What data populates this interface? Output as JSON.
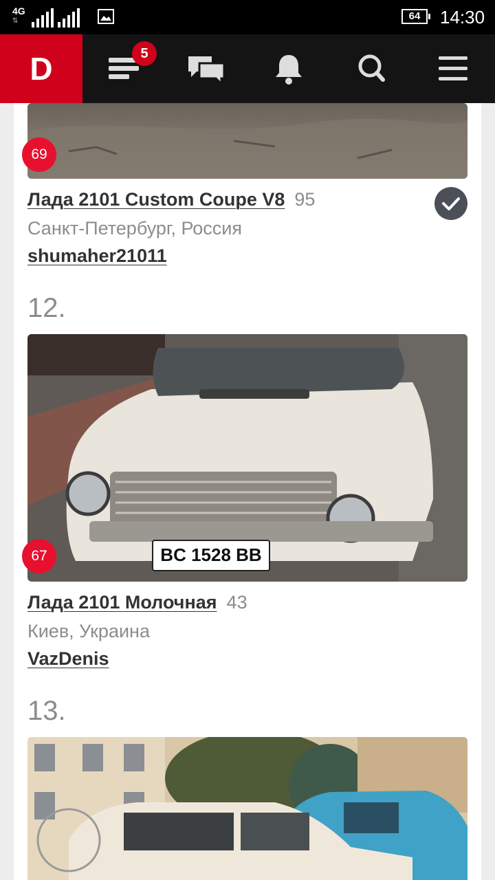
{
  "status_bar": {
    "network": "4G",
    "battery": "64",
    "time": "14:30"
  },
  "nav": {
    "logo": "D",
    "badge": "5",
    "icons": [
      "feed-icon",
      "messages-icon",
      "bell-icon",
      "search-icon",
      "menu-icon"
    ]
  },
  "entries": [
    {
      "rank": "69",
      "title": "Лада 2101 Custom Coupe V8",
      "score": "95",
      "location": "Санкт-Петербург, Россия",
      "author": "shumaher21011",
      "verified": true
    },
    {
      "number": "12.",
      "rank": "67",
      "title": "Лада 2101 Молочная",
      "score": "43",
      "location": "Киев, Украина",
      "author": "VazDenis",
      "plate": "BC 1528 BB"
    },
    {
      "number": "13."
    }
  ],
  "colors": {
    "brand_red": "#d0021b",
    "badge_red": "#e8102f",
    "nav_bg": "#141414"
  }
}
